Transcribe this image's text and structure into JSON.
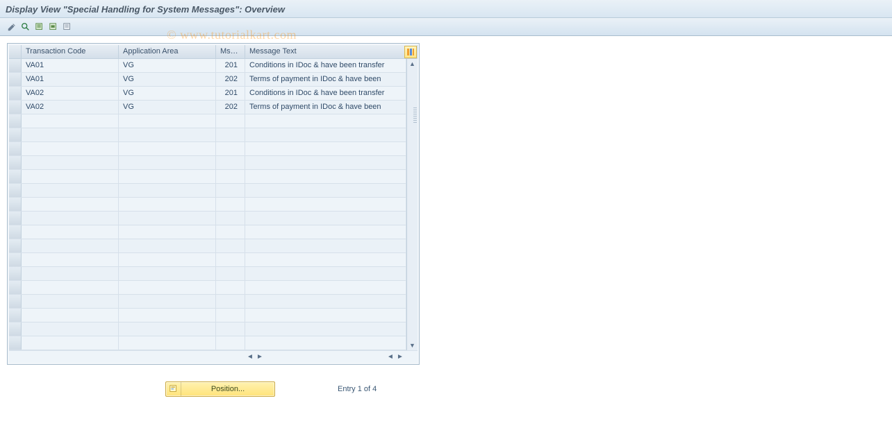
{
  "title": "Display View \"Special Handling for System Messages\": Overview",
  "watermark": "© www.tutorialkart.com",
  "toolbar_icons": [
    "toggle-edit",
    "other-view",
    "select-all",
    "select-block",
    "deselect-all"
  ],
  "columns": {
    "transaction_code": "Transaction Code",
    "application_area": "Application Area",
    "msg_no": "Msg...",
    "msg_text": "Message Text"
  },
  "rows": [
    {
      "tc": "VA01",
      "aa": "VG",
      "mn": "201",
      "mt": "Conditions in IDoc & have been transfer"
    },
    {
      "tc": "VA01",
      "aa": "VG",
      "mn": "202",
      "mt": "Terms of payment in IDoc & have been"
    },
    {
      "tc": "VA02",
      "aa": "VG",
      "mn": "201",
      "mt": "Conditions in IDoc & have been transfer"
    },
    {
      "tc": "VA02",
      "aa": "VG",
      "mn": "202",
      "mt": "Terms of payment in IDoc & have been"
    }
  ],
  "empty_row_count": 17,
  "footer": {
    "position_label": "Position...",
    "entry_text": "Entry 1 of 4"
  }
}
